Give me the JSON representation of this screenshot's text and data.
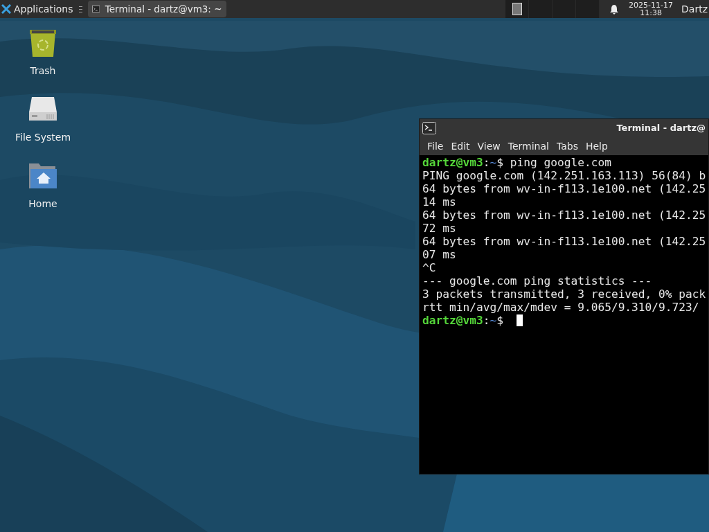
{
  "panel": {
    "menu_label": "Applications",
    "tasks": [
      {
        "label": "Terminal - dartz@vm3: ~",
        "selected": true
      }
    ],
    "workspaces": [
      {
        "has_window": true
      },
      {
        "has_window": false
      },
      {
        "has_window": false
      },
      {
        "has_window": false
      }
    ],
    "clock": {
      "date": "2025-11-17",
      "time": "11:38"
    },
    "user": "Dartz"
  },
  "desktop_icons": [
    {
      "kind": "trash",
      "label": "Trash"
    },
    {
      "kind": "drive",
      "label": "File System"
    },
    {
      "kind": "home",
      "label": "Home"
    }
  ],
  "terminal": {
    "title": "Terminal - dartz@",
    "menu": [
      "File",
      "Edit",
      "View",
      "Terminal",
      "Tabs",
      "Help"
    ],
    "lines": [
      {
        "kind": "prompt",
        "user_host": "dartz@vm3",
        "separator": ":",
        "path": "~",
        "sign": "$",
        "command": "ping google.com"
      },
      {
        "kind": "output",
        "text": "PING google.com (142.251.163.113) 56(84) b"
      },
      {
        "kind": "output",
        "text": "64 bytes from wv-in-f113.1e100.net (142.25"
      },
      {
        "kind": "output",
        "text": "14 ms"
      },
      {
        "kind": "output",
        "text": "64 bytes from wv-in-f113.1e100.net (142.25"
      },
      {
        "kind": "output",
        "text": "72 ms"
      },
      {
        "kind": "output",
        "text": "64 bytes from wv-in-f113.1e100.net (142.25"
      },
      {
        "kind": "output",
        "text": "07 ms"
      },
      {
        "kind": "output",
        "text": "^C"
      },
      {
        "kind": "output",
        "text": "--- google.com ping statistics ---"
      },
      {
        "kind": "output",
        "text": "3 packets transmitted, 3 received, 0% pack"
      },
      {
        "kind": "output",
        "text": "rtt min/avg/max/mdev = 9.065/9.310/9.723/"
      },
      {
        "kind": "prompt",
        "user_host": "dartz@vm3",
        "separator": ":",
        "path": "~",
        "sign": "$",
        "cursor": true
      }
    ]
  }
}
